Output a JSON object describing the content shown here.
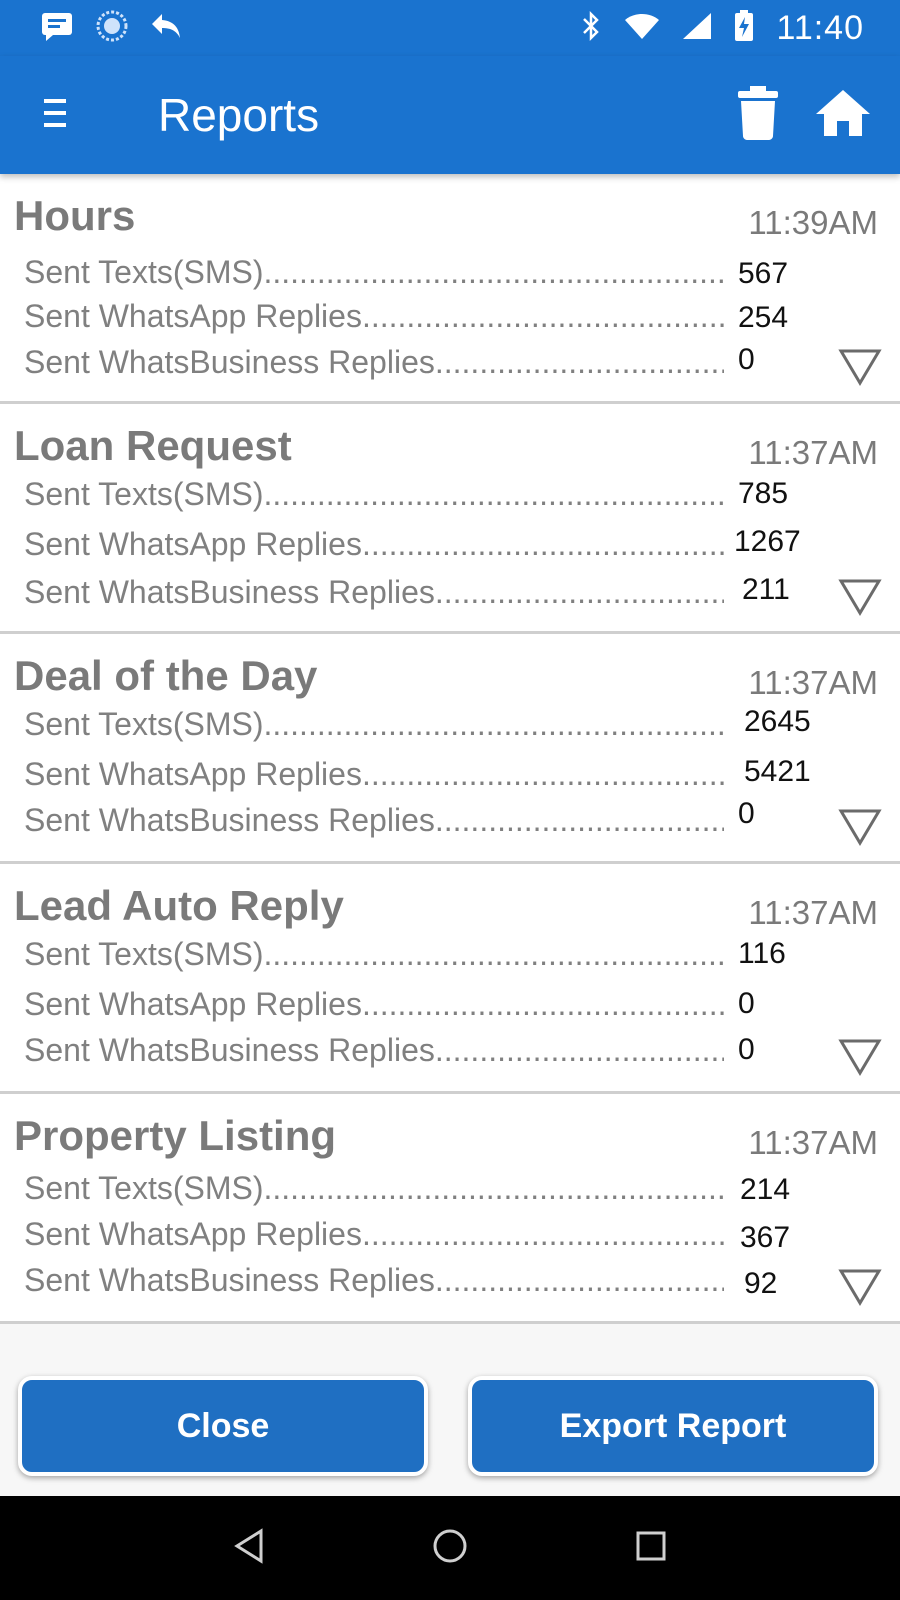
{
  "status_bar": {
    "time": "11:40",
    "left_icons": [
      "message-icon",
      "sync-icon",
      "reply-icon"
    ],
    "right_icons": [
      "bluetooth-icon",
      "wifi-icon",
      "signal-icon",
      "battery-charging-icon"
    ]
  },
  "app_bar": {
    "title": "Reports",
    "menu_icon": "menu-icon",
    "actions": [
      "trash-icon",
      "home-icon"
    ]
  },
  "reports": [
    {
      "title": "Hours",
      "time": "11:39AM",
      "rows": [
        {
          "label": "Sent Texts(SMS)",
          "value": "567"
        },
        {
          "label": "Sent WhatsApp Replies",
          "value": "254"
        },
        {
          "label": "Sent WhatsBusiness Replies",
          "value": "0"
        }
      ]
    },
    {
      "title": "Loan Request",
      "time": "11:37AM",
      "rows": [
        {
          "label": "Sent Texts(SMS)",
          "value": "785"
        },
        {
          "label": "Sent WhatsApp Replies",
          "value": "1267"
        },
        {
          "label": "Sent WhatsBusiness Replies",
          "value": "211"
        }
      ]
    },
    {
      "title": "Deal of the Day",
      "time": "11:37AM",
      "rows": [
        {
          "label": "Sent Texts(SMS)",
          "value": "2645"
        },
        {
          "label": "Sent WhatsApp Replies",
          "value": "5421"
        },
        {
          "label": "Sent WhatsBusiness Replies",
          "value": "0"
        }
      ]
    },
    {
      "title": "Lead Auto Reply",
      "time": "11:37AM",
      "rows": [
        {
          "label": "Sent Texts(SMS)",
          "value": "116"
        },
        {
          "label": "Sent WhatsApp Replies",
          "value": "0"
        },
        {
          "label": "Sent WhatsBusiness Replies",
          "value": "0"
        }
      ]
    },
    {
      "title": "Property Listing",
      "time": "11:37AM",
      "rows": [
        {
          "label": "Sent Texts(SMS)",
          "value": "214"
        },
        {
          "label": "Sent WhatsApp Replies",
          "value": "367"
        },
        {
          "label": "Sent WhatsBusiness Replies",
          "value": "92"
        }
      ]
    }
  ],
  "footer": {
    "close_label": "Close",
    "export_label": "Export Report"
  },
  "nav_bar": {
    "icons": [
      "back-icon",
      "home-circle-icon",
      "recents-icon"
    ]
  },
  "colors": {
    "primary": "#1a73cf",
    "button": "#1f6fc2",
    "text_muted": "#7a7a7a"
  }
}
